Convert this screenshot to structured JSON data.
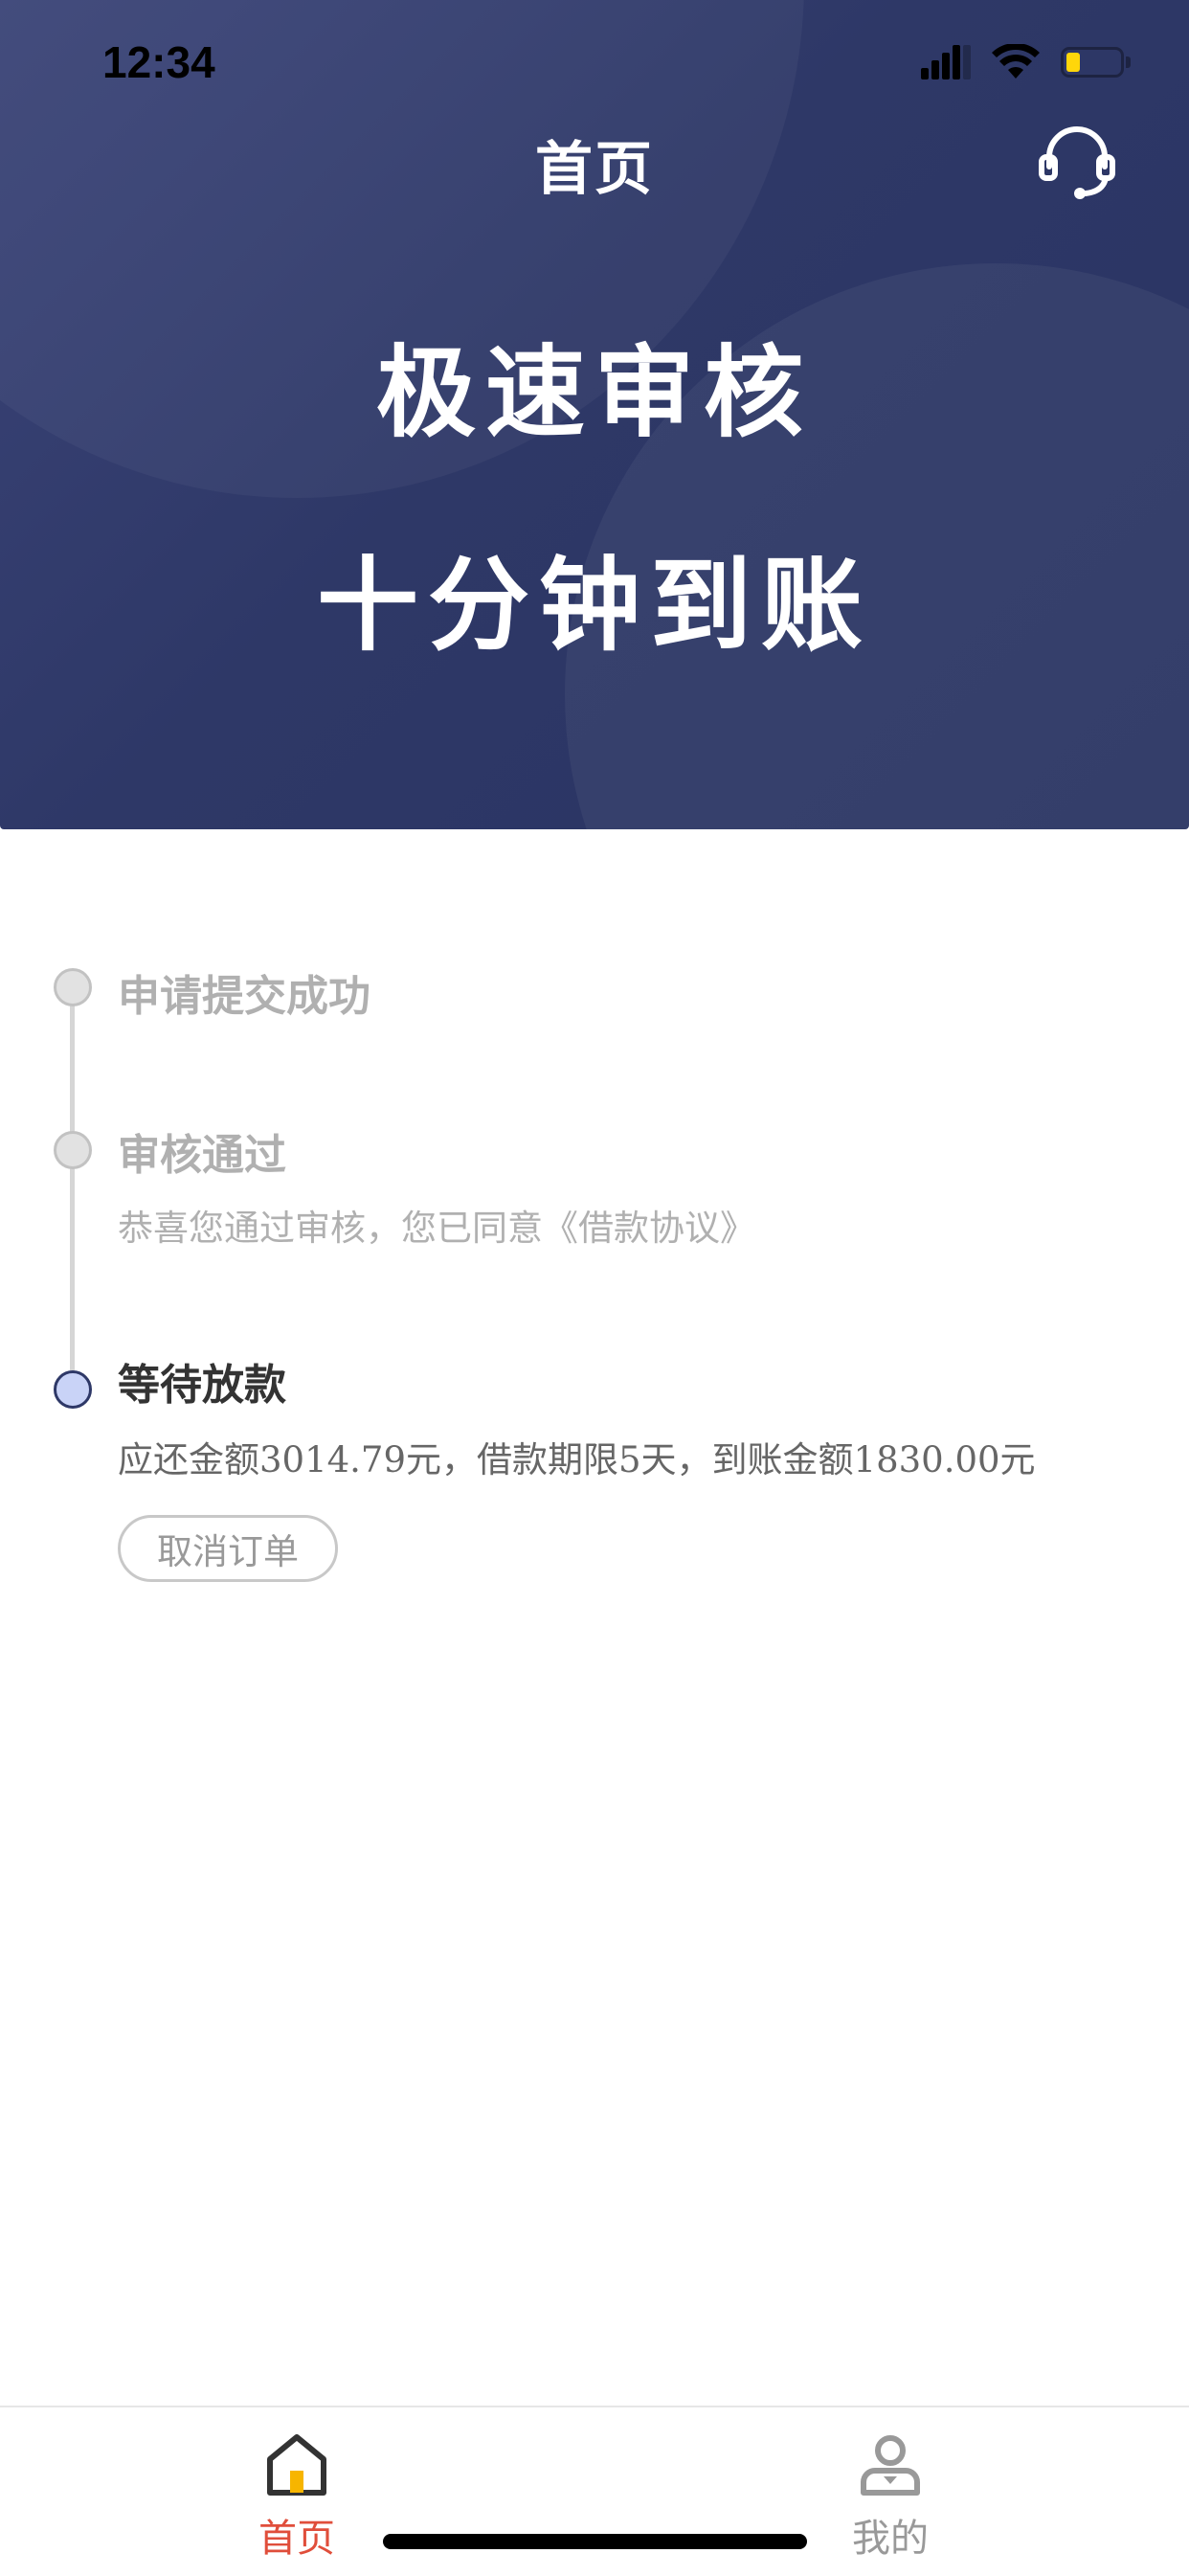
{
  "status_bar": {
    "time": "12:34",
    "battery_level": 0.25
  },
  "header": {
    "title": "首页",
    "support_icon": "headset-icon"
  },
  "banner": {
    "line1": "极速审核",
    "line2": "十分钟到账"
  },
  "progress": {
    "steps": [
      {
        "title": "申请提交成功",
        "description": "",
        "state": "done"
      },
      {
        "title": "审核通过",
        "description": "恭喜您通过审核，您已同意《借款协议》",
        "state": "done"
      },
      {
        "title": "等待放款",
        "description": "应还金额3014.79元，借款期限5天，到账金额1830.00元",
        "state": "current"
      }
    ],
    "cancel_label": "取消订单"
  },
  "tabbar": {
    "items": [
      {
        "label": "首页",
        "icon": "home-icon",
        "active": true
      },
      {
        "label": "我的",
        "icon": "user-icon",
        "active": false
      }
    ]
  },
  "colors": {
    "header_bg": "#2e3867",
    "active_tab": "#e04e3b",
    "current_step_fill": "#c9d3f7",
    "battery": "#ffd60a"
  }
}
